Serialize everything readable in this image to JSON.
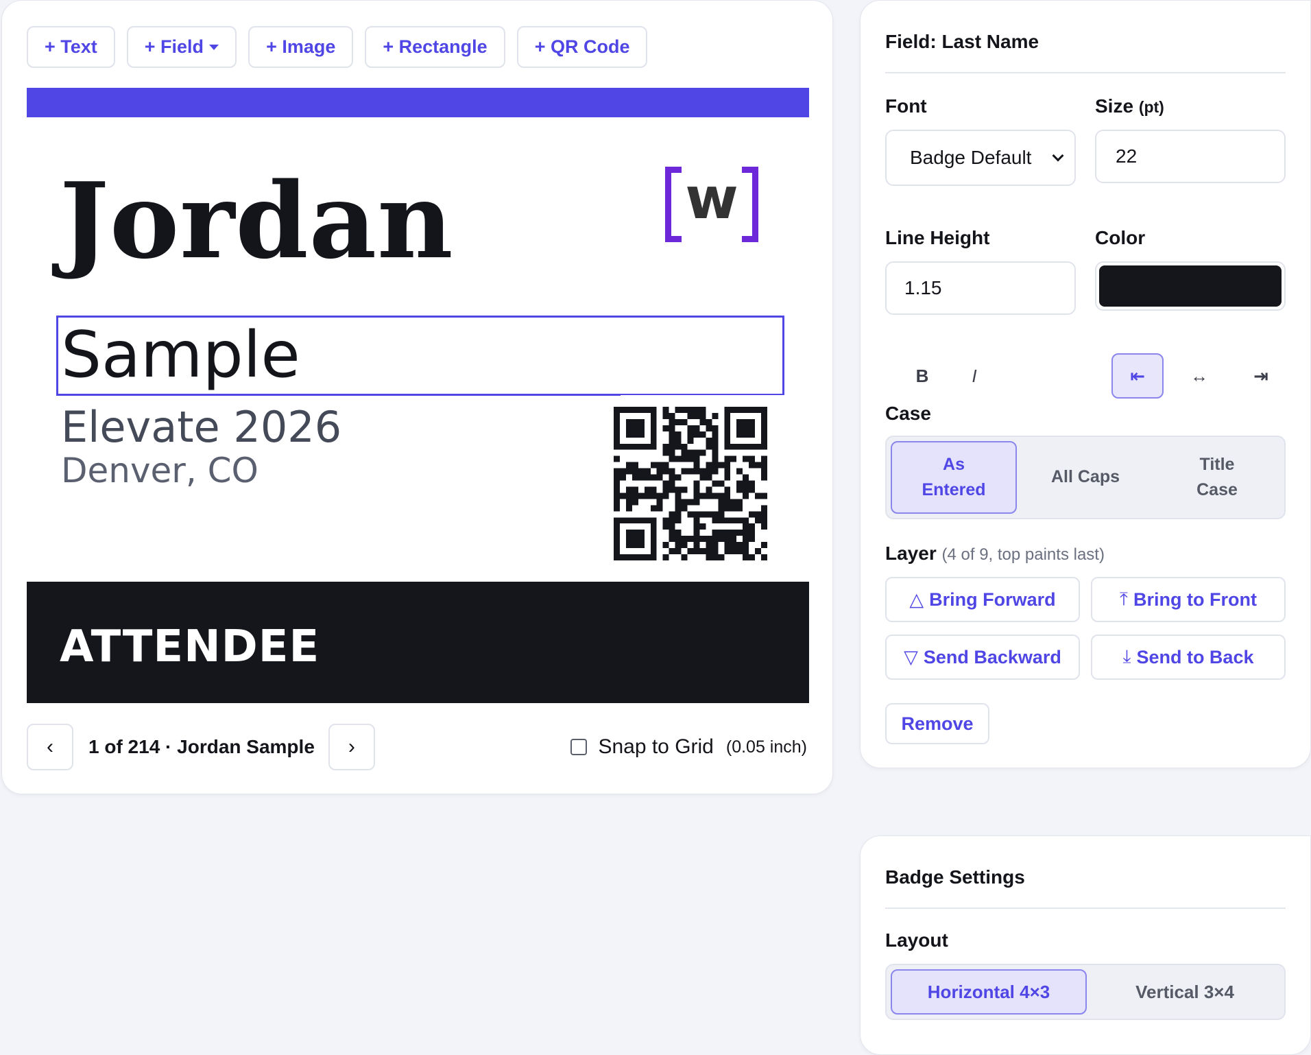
{
  "toolbar": {
    "add_text": "+ Text",
    "add_field": "+ Field",
    "add_image": "+ Image",
    "add_rectangle": "+ Rectangle",
    "add_qr": "+ QR Code"
  },
  "badge": {
    "first_name": "Jordan",
    "last_name": "Sample",
    "event": "Elevate 2026",
    "city": "Denver, CO",
    "role": "ATTENDEE",
    "logo_text": "w",
    "accent_color": "#4f46e5",
    "logo_color": "#6d28d9",
    "role_bar_color": "#15161c"
  },
  "pager": {
    "prev": "‹",
    "next": "›",
    "label": "1 of 214 · Jordan Sample"
  },
  "snap": {
    "label": "Snap to Grid",
    "unit": "(0.05 inch)",
    "checked": false
  },
  "field_panel": {
    "title": "Field: Last Name",
    "font_label": "Font",
    "font_value": "Badge Default",
    "size_label": "Size",
    "size_unit": "(pt)",
    "size_value": "22",
    "line_height_label": "Line Height",
    "line_height_value": "1.15",
    "color_label": "Color",
    "color_value": "#15161c",
    "bold": "B",
    "italic": "I",
    "align_left": "⇤",
    "align_center": "↔",
    "align_right": "⇥",
    "align_selected": "left",
    "case_label": "Case",
    "case_options": [
      "As Entered",
      "All Caps",
      "Title Case"
    ],
    "case_selected": "As Entered",
    "layer_label": "Layer",
    "layer_info": "(4 of 9, top paints last)",
    "bring_forward": "Bring Forward",
    "bring_to_front": "Bring to Front",
    "send_backward": "Send Backward",
    "send_to_back": "Send to Back",
    "remove": "Remove"
  },
  "settings_panel": {
    "title": "Badge Settings",
    "layout_label": "Layout",
    "layout_options": [
      "Horizontal 4×3",
      "Vertical 3×4"
    ],
    "layout_selected": "Horizontal 4×3"
  }
}
